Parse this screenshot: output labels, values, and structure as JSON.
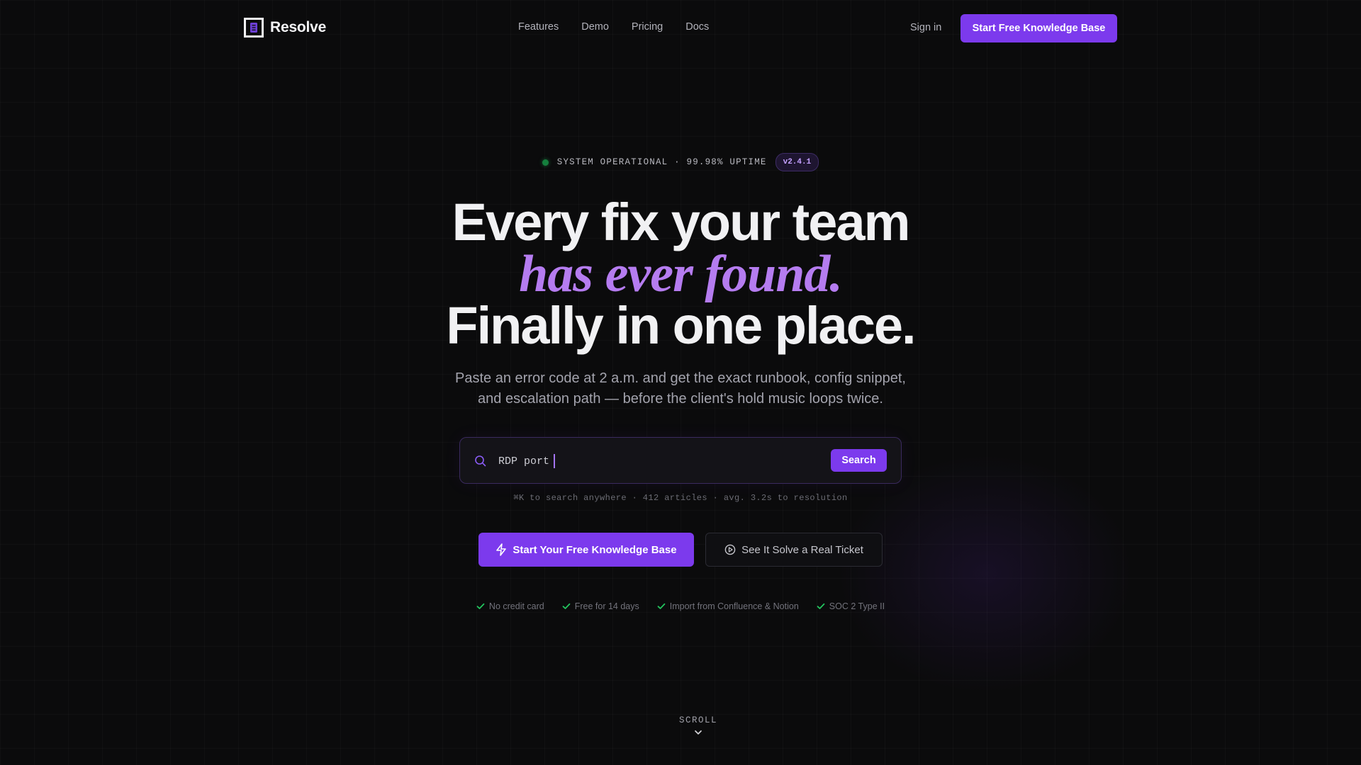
{
  "nav": {
    "brand_name": "Resolve",
    "links": [
      "Features",
      "Demo",
      "Pricing",
      "Docs"
    ],
    "sign_in_label": "Sign in",
    "cta_label": "Start Free Knowledge Base"
  },
  "status": {
    "text": "SYSTEM OPERATIONAL · 99.98% UPTIME",
    "version": "v2.4.1",
    "dot_color": "#15803d"
  },
  "hero": {
    "line1": "Every fix your team",
    "line2": "has ever found.",
    "line3": "Finally in one place.",
    "subheadline": "Paste an error code at 2 a.m. and get the exact runbook, config snippet, and escalation path — before the client's hold music loops twice."
  },
  "search": {
    "value": "RDP port",
    "button_label": "Search",
    "hint": "⌘K to search anywhere · 412 articles · avg. 3.2s to resolution"
  },
  "ctas": {
    "primary_label": "Start Your Free Knowledge Base",
    "secondary_label": "See It Solve a Real Ticket"
  },
  "features": [
    "No credit card",
    "Free for 14 days",
    "Import from Confluence & Notion",
    "SOC 2 Type II"
  ],
  "scroll_label": "SCROLL",
  "colors": {
    "accent": "#7c3aed",
    "accent_text": "#b57cf0",
    "background": "#0b0b0c",
    "check": "#22c55e"
  },
  "icons": [
    "logo-icon",
    "search-icon",
    "bolt-icon",
    "play-circle-icon",
    "check-icon",
    "chevron-down-icon"
  ]
}
